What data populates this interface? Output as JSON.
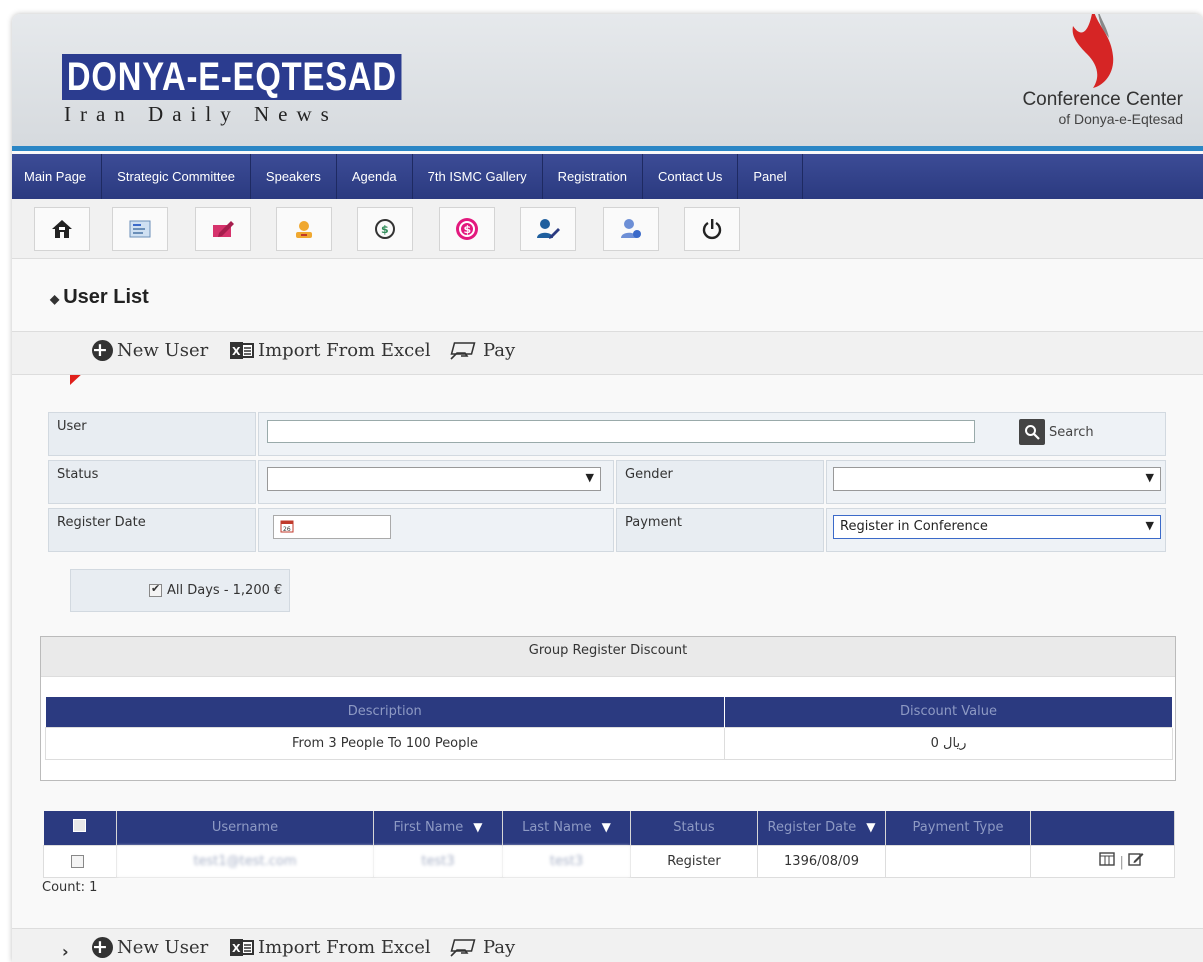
{
  "header": {
    "logo_main": "DONYA-E-EQTESAD",
    "logo_sub": "Iran Daily News",
    "conference_title": "Conference Center",
    "conference_subtitle": "of Donya-e-Eqtesad"
  },
  "nav": {
    "items": [
      "Main Page",
      "Strategic Committee",
      "Speakers",
      "Agenda",
      "7th ISMC Gallery",
      "Registration",
      "Contact Us",
      "Panel"
    ]
  },
  "toolbar": {
    "icons": [
      "home-icon",
      "form-icon",
      "edit-card-icon",
      "user-badge-icon",
      "money-refresh-icon",
      "payment-circle-icon",
      "user-edit-icon",
      "user-info-icon",
      "power-icon"
    ]
  },
  "page": {
    "title": "User List"
  },
  "actions": {
    "new_user": "New User",
    "import_excel": "Import From Excel",
    "pay": "Pay"
  },
  "filters": {
    "user_label": "User",
    "user_value": "",
    "search_label": "Search",
    "status_label": "Status",
    "status_value": "",
    "gender_label": "Gender",
    "gender_value": "",
    "register_date_label": "Register Date",
    "register_date_value": "",
    "payment_label": "Payment",
    "payment_value": "Register in Conference",
    "days_option": "All Days - 1,200 €",
    "days_checked": true
  },
  "discount": {
    "title": "Group Register Discount",
    "columns": [
      "Description",
      "Discount Value"
    ],
    "rows": [
      [
        "From 3 People To 100 People",
        "0 ریال"
      ]
    ]
  },
  "users_table": {
    "columns": [
      "Username",
      "First Name",
      "Last Name",
      "Status",
      "Register Date",
      "Payment Type"
    ],
    "rows": [
      {
        "username": "test1@test.com",
        "first_name": "test3",
        "last_name": "test3",
        "status": "Register",
        "register_date": "1396/08/09",
        "payment_type": ""
      }
    ],
    "count": "Count: 1"
  },
  "colors": {
    "nav": "#2b3a80",
    "accent_line": "#2b86c5",
    "arrow": "#e0201b"
  }
}
